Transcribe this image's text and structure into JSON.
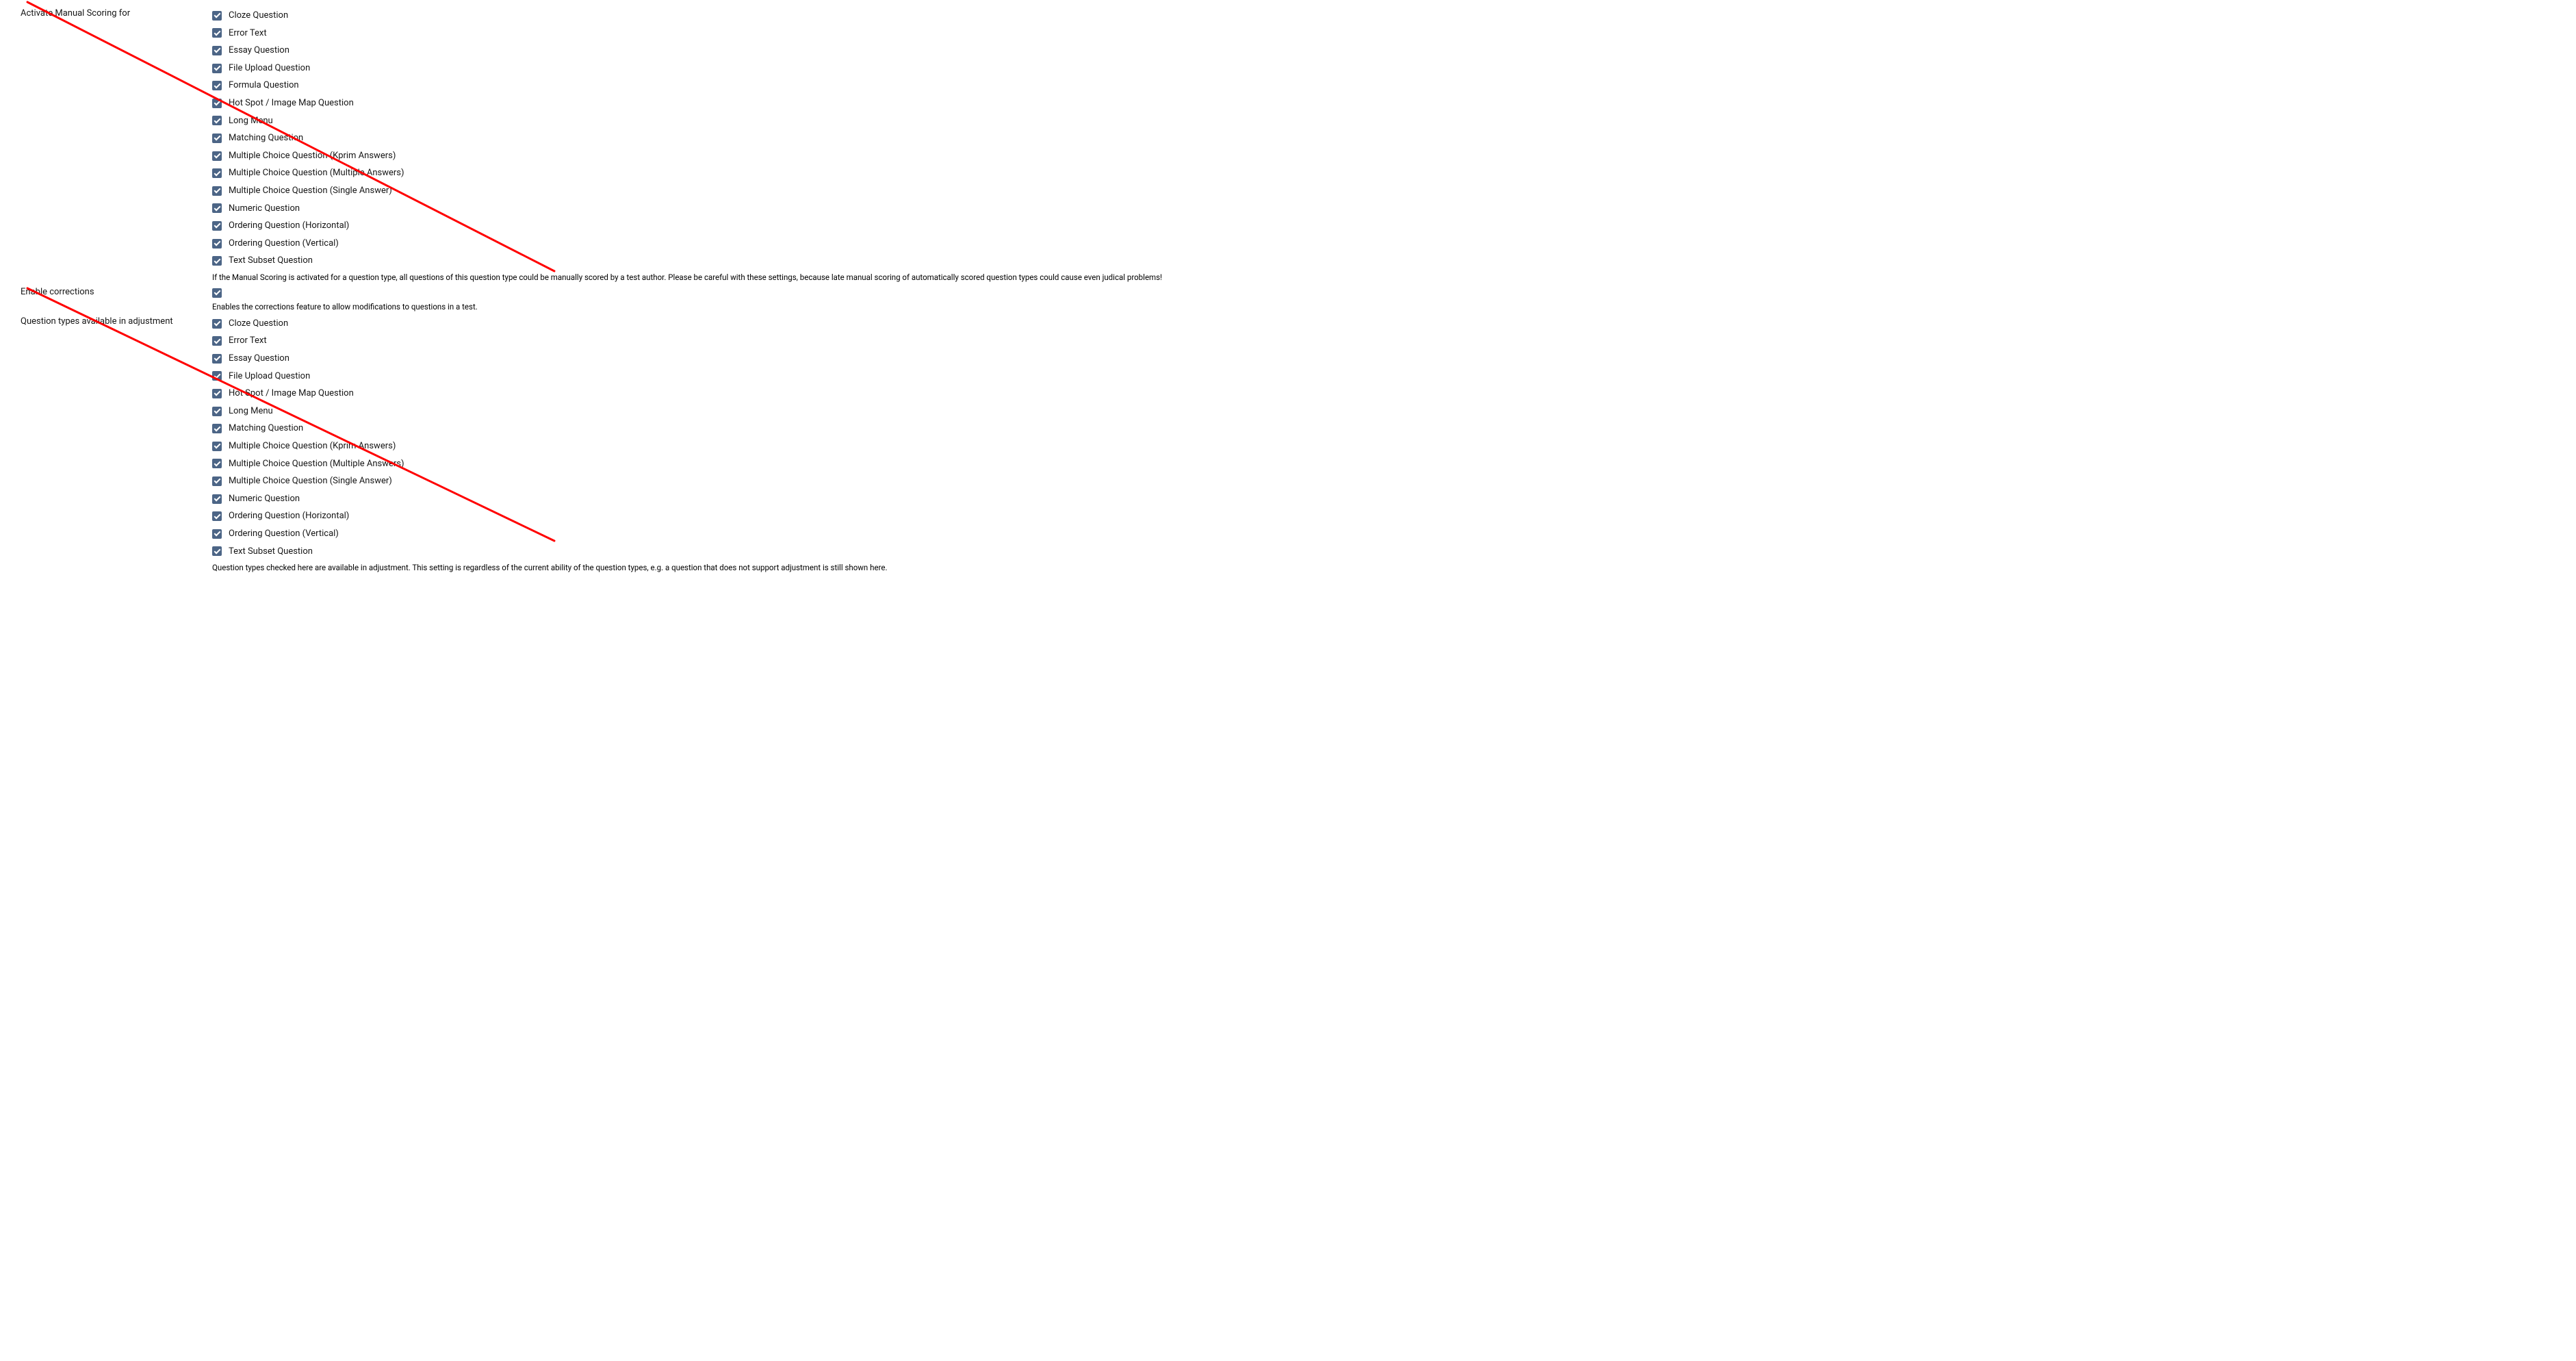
{
  "sections": {
    "manual_scoring": {
      "label": "Activate Manual Scoring for",
      "help": "If the Manual Scoring is activated for a question type, all questions of this question type could be manually scored by a test author. Please be careful with these settings, because late manual scoring of automatically scored question types could cause even judical problems!",
      "options": [
        "Cloze Question",
        "Error Text",
        "Essay Question",
        "File Upload Question",
        "Formula Question",
        "Hot Spot / Image Map Question",
        "Long Menu",
        "Matching Question",
        "Multiple Choice Question (Kprim Answers)",
        "Multiple Choice Question (Multiple Answers)",
        "Multiple Choice Question (Single Answer)",
        "Numeric Question",
        "Ordering Question (Horizontal)",
        "Ordering Question (Vertical)",
        "Text Subset Question"
      ]
    },
    "enable_corrections": {
      "label": "Enable corrections",
      "help": "Enables the corrections feature to allow modifications to questions in a test."
    },
    "adjustment": {
      "label": "Question types available in adjustment",
      "help": "Question types checked here are available in adjustment. This setting is regardless of the current ability of the question types, e.g. a question that does not support adjustment is still shown here.",
      "options": [
        "Cloze Question",
        "Error Text",
        "Essay Question",
        "File Upload Question",
        "Hot Spot / Image Map Question",
        "Long Menu",
        "Matching Question",
        "Multiple Choice Question (Kprim Answers)",
        "Multiple Choice Question (Multiple Answers)",
        "Multiple Choice Question (Single Answer)",
        "Numeric Question",
        "Ordering Question (Horizontal)",
        "Ordering Question (Vertical)",
        "Text Subset Question"
      ]
    }
  }
}
